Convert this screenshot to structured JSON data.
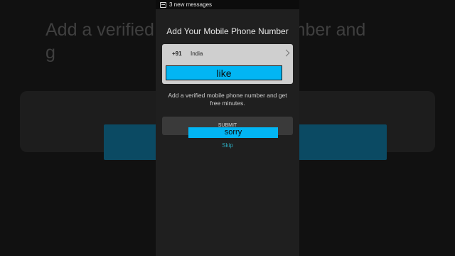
{
  "status_bar": {
    "notification": "3 new messages",
    "icon": "message-icon"
  },
  "background": {
    "title_line1": "Add a verified mobile phone number and",
    "title_line2": "g"
  },
  "screen": {
    "title": "Add Your Mobile Phone Number",
    "country": {
      "dial_code": "+91",
      "name": "India",
      "icon": "chevron-right-icon"
    },
    "phone_field": {
      "value": "like"
    },
    "subtitle": "Add a verified mobile phone number and get free minutes.",
    "submit_label": "SUBMIT",
    "caption": "sorry",
    "skip_label": "Skip"
  },
  "colors": {
    "accent": "#02b5f3",
    "link": "#2ba5b8",
    "card": "#cfcfcf"
  }
}
